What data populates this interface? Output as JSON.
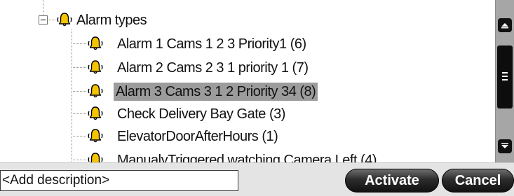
{
  "tree": {
    "root": {
      "label": "Alarm types",
      "expanded": true
    },
    "items": [
      {
        "label": "Alarm 1 Cams 1 2 3 Priority1 (6)",
        "selected": false
      },
      {
        "label": "Alarm 2 Cams 2 3 1 priority 1 (7)",
        "selected": false
      },
      {
        "label": "Alarm 3 Cams 3 1 2 Priority 34 (8)",
        "selected": true
      },
      {
        "label": "Check Delivery Bay Gate (3)",
        "selected": false
      },
      {
        "label": "ElevatorDoorAfterHours (1)",
        "selected": false
      },
      {
        "label": "ManualyTriggered watching Camera Left (4)",
        "selected": false
      }
    ]
  },
  "description": {
    "placeholder": "<Add description>",
    "value": ""
  },
  "buttons": {
    "activate": "Activate",
    "cancel": "Cancel"
  },
  "icons": {
    "alarm": "bell-icon",
    "expander": "minus-box-icon"
  },
  "colors": {
    "selection": "#9c9c9c",
    "bell_fill": "#f5c400",
    "scrollbar_track": "#a6a6a6",
    "button_dark": "#111111"
  }
}
